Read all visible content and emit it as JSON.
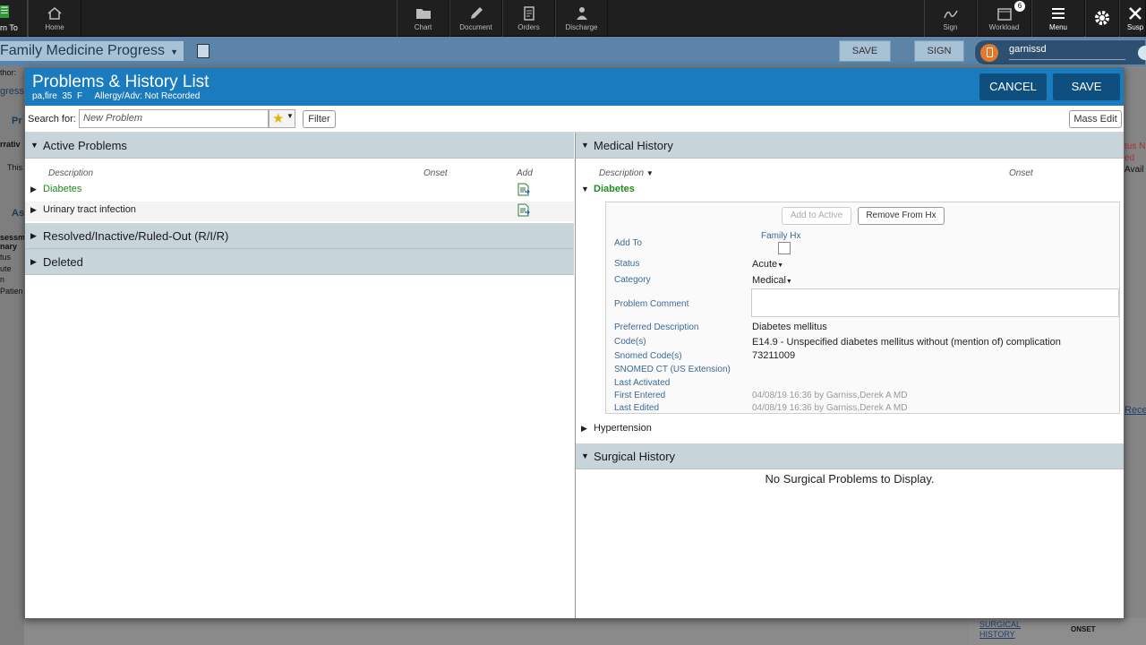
{
  "topnav": {
    "turn_to": "rn To",
    "items": [
      {
        "label": "Home"
      },
      {
        "label": "Chart"
      },
      {
        "label": "Document"
      },
      {
        "label": "Orders"
      },
      {
        "label": "Discharge"
      },
      {
        "label": "Sign"
      },
      {
        "label": "Workload",
        "badge": "6"
      },
      {
        "label": "Menu"
      },
      {
        "label": "Susp"
      }
    ]
  },
  "background": {
    "doc_title": "Family Medicine Progress",
    "save_label": "SAVE",
    "sign_label": "SIGN",
    "user": "garnissd",
    "left_fragments": [
      "thor:",
      "gress",
      "Pr",
      "rrativ",
      "This",
      "As",
      "sessm",
      "nary",
      "tus",
      "ute",
      "n",
      "Patien"
    ],
    "right_fragments": [
      "tus N",
      "ed",
      "Avail",
      "Rece"
    ],
    "bottom_link": "SURGICAL HISTORY",
    "bottom_onset": "ONSET"
  },
  "modal": {
    "title": "Problems & History List",
    "patient": "pa,fire  35  F",
    "allergy": "Allergy/Adv: Not Recorded",
    "cancel_label": "CANCEL",
    "save_label": "SAVE",
    "search_label": "Search for:",
    "search_placeholder": "New Problem",
    "filter_label": "Filter",
    "mass_edit_label": "Mass Edit"
  },
  "active_problems": {
    "title": "Active Problems",
    "col_description": "Description",
    "col_onset": "Onset",
    "col_add": "Add",
    "rows": [
      {
        "name": "Diabetes"
      },
      {
        "name": "Urinary tract infection"
      }
    ]
  },
  "left_sections": [
    {
      "title": "Resolved/Inactive/Ruled-Out (R/I/R)"
    },
    {
      "title": "Deleted"
    }
  ],
  "medical_history": {
    "title": "Medical History",
    "col_description": "Description",
    "col_onset": "Onset",
    "expanded": {
      "name": "Diabetes",
      "add_to_active": "Add to Active",
      "remove_from_hx": "Remove From Hx",
      "add_to_label": "Add To",
      "family_hx": "Family Hx",
      "status_label": "Status",
      "status_value": "Acute",
      "category_label": "Category",
      "category_value": "Medical",
      "comment_label": "Problem Comment",
      "pref_desc_label": "Preferred Description",
      "pref_desc_value": "Diabetes mellitus",
      "codes_label": "Code(s)",
      "codes_value": "E14.9 - Unspecified diabetes mellitus without (mention of) complication",
      "snomed_label": "Snomed Code(s)",
      "snomed_value": "73211009",
      "snomed_us_label": "SNOMED CT (US Extension)",
      "last_activated_label": "Last Activated",
      "first_entered_label": "First Entered",
      "first_entered_value": "04/08/19 16:36 by Garniss,Derek A MD",
      "last_edited_label": "Last Edited",
      "last_edited_value": "04/08/19 16:36 by Garniss,Derek A MD"
    },
    "other": [
      {
        "name": "Hypertension"
      }
    ]
  },
  "surgical_history": {
    "title": "Surgical History",
    "empty_text": "No Surgical Problems to Display."
  }
}
